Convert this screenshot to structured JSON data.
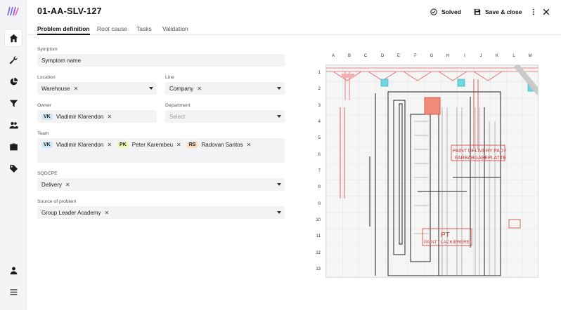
{
  "app": {
    "logo": "logo-icon"
  },
  "sidebar": {
    "items": [
      {
        "icon": "home-icon",
        "active": true
      },
      {
        "icon": "wrench-icon"
      },
      {
        "icon": "pie-chart-icon"
      },
      {
        "icon": "filter-icon"
      },
      {
        "icon": "users-icon"
      },
      {
        "icon": "briefcase-icon"
      },
      {
        "icon": "tag-icon"
      }
    ],
    "bottom": [
      {
        "icon": "user-icon"
      },
      {
        "icon": "menu-icon"
      }
    ]
  },
  "header": {
    "title": "01-AA-SLV-127",
    "solved_label": "Solved",
    "save_label": "Save & close"
  },
  "tabs": [
    "Problem definition",
    "Root cause",
    "Tasks",
    "Validation"
  ],
  "form": {
    "symptom_label": "Symptom",
    "symptom_value": "Symptom name",
    "location_label": "Location",
    "location_value": "Warehouse",
    "line_label": "Line",
    "line_value": "Company",
    "owner_label": "Owner",
    "owner_initials": "VK",
    "owner_name": "Vladimir Klarendon",
    "department_label": "Department",
    "department_placeholder": "Select",
    "team_label": "Team",
    "team": [
      {
        "initials": "VK",
        "name": "Vladimir Klarendon",
        "color": "#cfe6f5"
      },
      {
        "initials": "PK",
        "name": "Peter Karembeu",
        "color": "#eef5b8"
      },
      {
        "initials": "RS",
        "name": "Radovan Santos",
        "color": "#f8dcc2"
      }
    ],
    "sqdcpe_label": "SQDCPE",
    "sqdcpe_value": "Delivery",
    "source_label": "Source of problem",
    "source_value": "Group Leader Academy"
  },
  "plan": {
    "columns": [
      "A",
      "B",
      "C",
      "D",
      "E",
      "F",
      "G",
      "H",
      "I",
      "J",
      "K",
      "L",
      "M"
    ],
    "rows": [
      "1",
      "2",
      "3",
      "4",
      "5",
      "6",
      "7",
      "8",
      "9",
      "10",
      "11",
      "12",
      "13"
    ],
    "label_paint_delivery_1": "PAINT DELIVERY PAD /",
    "label_paint_delivery_2": "FARBABGABEPLATTE",
    "label_pt": "PT",
    "label_paint": "PAINT / LACKIEREREI"
  }
}
